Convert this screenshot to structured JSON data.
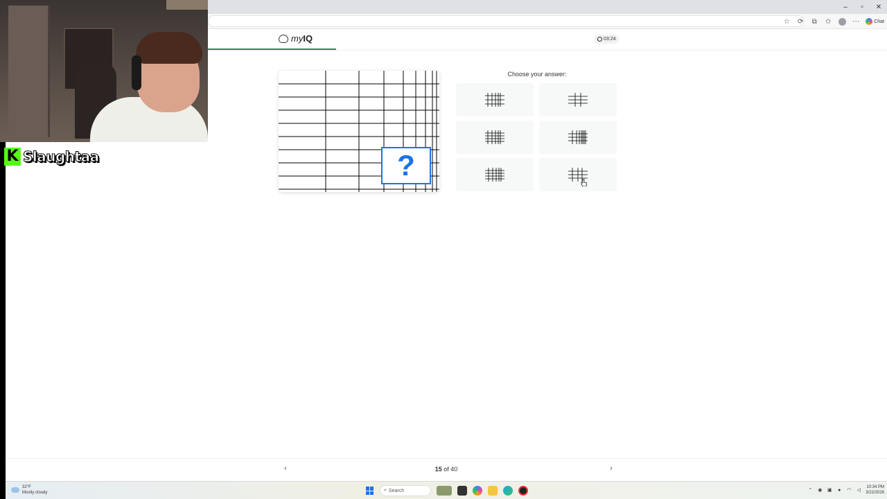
{
  "browser": {
    "window_controls": [
      "–",
      "▫",
      "✕"
    ],
    "chat_label": "Chat"
  },
  "site": {
    "logo_my": "my",
    "logo_iq": "IQ",
    "timer": "03:24",
    "progress_fraction": 0.375,
    "brand_color": "#1f8a5b",
    "accent_color": "#1a73e8"
  },
  "puzzle": {
    "question_mark": "?",
    "prompt": "Choose your answer:"
  },
  "answers": [
    {
      "id": "option-1",
      "icon": "grid-pattern-icon"
    },
    {
      "id": "option-2",
      "icon": "grid-pattern-icon"
    },
    {
      "id": "option-3",
      "icon": "grid-pattern-icon"
    },
    {
      "id": "option-4",
      "icon": "grid-pattern-icon"
    },
    {
      "id": "option-5",
      "icon": "grid-pattern-icon"
    },
    {
      "id": "option-6",
      "icon": "grid-pattern-icon"
    }
  ],
  "pager": {
    "current": "15",
    "separator": "of",
    "total": "40"
  },
  "taskbar": {
    "temperature": "32°F",
    "weather": "Mostly cloudy",
    "search_placeholder": "Search",
    "time": "10:34 PM",
    "date": "3/22/2026"
  },
  "stream": {
    "platform_icon": "K",
    "streamer_name": "Slaughtaa"
  }
}
